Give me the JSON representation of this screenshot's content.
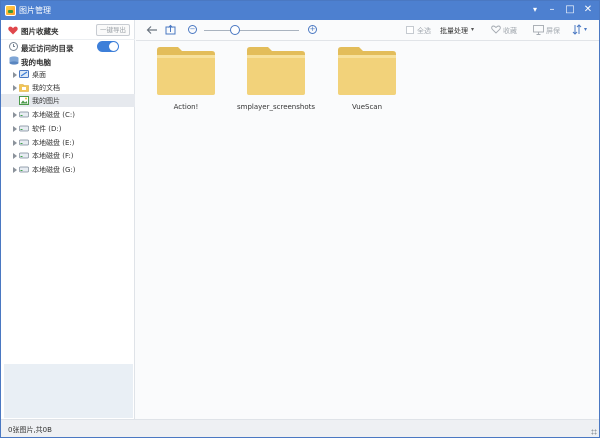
{
  "window": {
    "title": "图片管理"
  },
  "sidebar": {
    "favorites_label": "图片收藏夹",
    "export_label": "一键导出",
    "recent_label": "最近访问的目录",
    "recent_enabled": true,
    "computer_label": "我的电脑",
    "items": [
      {
        "label": "桌面",
        "icon": "desktop-icon"
      },
      {
        "label": "我的文档",
        "icon": "documents-folder-icon"
      },
      {
        "label": "我的图片",
        "icon": "pictures-icon",
        "selected": true
      },
      {
        "label": "本地磁盘 (C:)",
        "icon": "drive-icon"
      },
      {
        "label": "软件 (D:)",
        "icon": "drive-icon"
      },
      {
        "label": "本地磁盘 (E:)",
        "icon": "drive-icon"
      },
      {
        "label": "本地磁盘 (F:)",
        "icon": "drive-icon"
      },
      {
        "label": "本地磁盘 (G:)",
        "icon": "drive-icon"
      }
    ]
  },
  "toolbar": {
    "zoom_percent": 33,
    "select_all_label": "全选",
    "batch_label": "批量处理",
    "favorite_label": "收藏",
    "screen_label": "屏保"
  },
  "folders": [
    {
      "name": "Action!"
    },
    {
      "name": "smplayer_screenshots"
    },
    {
      "name": "VueScan"
    }
  ],
  "status": {
    "text": "0张图片,共0B"
  },
  "colors": {
    "accent": "#4d80d0",
    "folder": "#f2d27a",
    "heart": "#e0474c"
  }
}
